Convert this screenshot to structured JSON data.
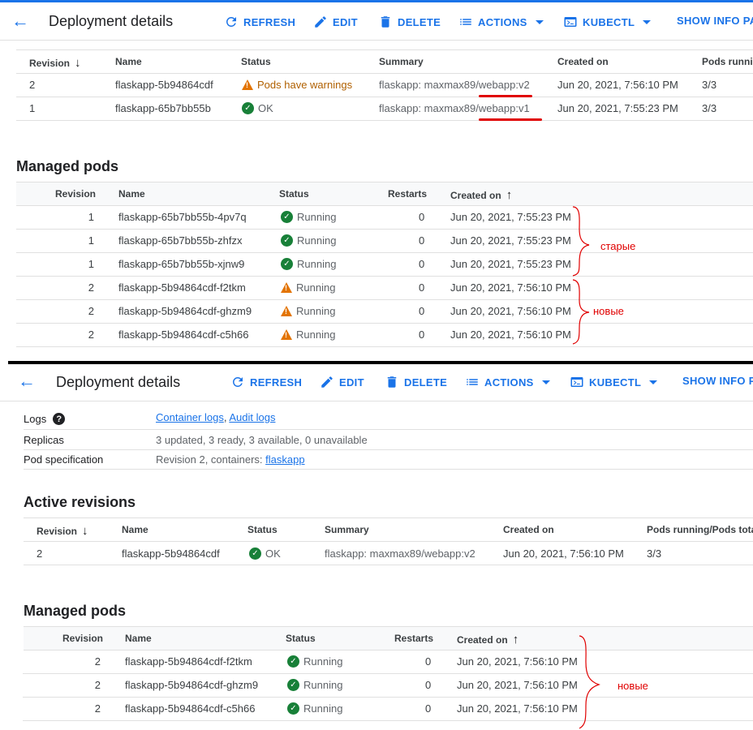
{
  "toolbar": {
    "title": "Deployment details",
    "refresh": "REFRESH",
    "edit": "EDIT",
    "delete": "DELETE",
    "actions": "ACTIONS",
    "kubectl": "KUBECTL",
    "show_info_top": "SHOW INFO PA",
    "show_info_bottom": "SHOW INFO P"
  },
  "top_revisions": {
    "headers": {
      "revision": "Revision",
      "name": "Name",
      "status": "Status",
      "summary": "Summary",
      "created": "Created on",
      "pods": "Pods runnin"
    },
    "rows": [
      {
        "revision": "2",
        "name": "flaskapp-5b94864cdf",
        "status": "Pods have warnings",
        "summary": "flaskapp: maxmax89/webapp:v2",
        "created": "Jun 20, 2021, 7:56:10 PM",
        "pods": "3/3"
      },
      {
        "revision": "1",
        "name": "flaskapp-65b7bb55b",
        "status": "OK",
        "summary": "flaskapp: maxmax89/webapp:v1",
        "created": "Jun 20, 2021, 7:55:23 PM",
        "pods": "3/3"
      }
    ]
  },
  "top_pods": {
    "section_title": "Managed pods",
    "headers": {
      "revision": "Revision",
      "name": "Name",
      "status": "Status",
      "restarts": "Restarts",
      "created": "Created on"
    },
    "rows": [
      {
        "revision": "1",
        "name": "flaskapp-65b7bb55b-4pv7q",
        "status": "Running",
        "restarts": "0",
        "created": "Jun 20, 2021, 7:55:23 PM"
      },
      {
        "revision": "1",
        "name": "flaskapp-65b7bb55b-zhfzx",
        "status": "Running",
        "restarts": "0",
        "created": "Jun 20, 2021, 7:55:23 PM"
      },
      {
        "revision": "1",
        "name": "flaskapp-65b7bb55b-xjnw9",
        "status": "Running",
        "restarts": "0",
        "created": "Jun 20, 2021, 7:55:23 PM"
      },
      {
        "revision": "2",
        "name": "flaskapp-5b94864cdf-f2tkm",
        "status": "Running",
        "restarts": "0",
        "created": "Jun 20, 2021, 7:56:10 PM"
      },
      {
        "revision": "2",
        "name": "flaskapp-5b94864cdf-ghzm9",
        "status": "Running",
        "restarts": "0",
        "created": "Jun 20, 2021, 7:56:10 PM"
      },
      {
        "revision": "2",
        "name": "flaskapp-5b94864cdf-c5h66",
        "status": "Running",
        "restarts": "0",
        "created": "Jun 20, 2021, 7:56:10 PM"
      }
    ],
    "annotations": {
      "old": "старые",
      "new": "новые"
    }
  },
  "info": {
    "logs_label": "Logs",
    "logs_link1": "Container logs",
    "logs_sep": ",",
    "logs_link2": "Audit logs",
    "replicas_label": "Replicas",
    "replicas_value": "3 updated, 3 ready, 3 available, 0 unavailable",
    "podspec_label": "Pod specification",
    "podspec_value": "Revision 2, containers:",
    "podspec_link": "flaskapp"
  },
  "active_revisions": {
    "section_title": "Active revisions",
    "headers": {
      "revision": "Revision",
      "name": "Name",
      "status": "Status",
      "summary": "Summary",
      "created": "Created on",
      "pods": "Pods running/Pods tota"
    },
    "rows": [
      {
        "revision": "2",
        "name": "flaskapp-5b94864cdf",
        "status": "OK",
        "summary": "flaskapp: maxmax89/webapp:v2",
        "created": "Jun 20, 2021, 7:56:10 PM",
        "pods": "3/3"
      }
    ]
  },
  "bottom_pods": {
    "section_title": "Managed pods",
    "headers": {
      "revision": "Revision",
      "name": "Name",
      "status": "Status",
      "restarts": "Restarts",
      "created": "Created on"
    },
    "rows": [
      {
        "revision": "2",
        "name": "flaskapp-5b94864cdf-f2tkm",
        "status": "Running",
        "restarts": "0",
        "created": "Jun 20, 2021, 7:56:10 PM"
      },
      {
        "revision": "2",
        "name": "flaskapp-5b94864cdf-ghzm9",
        "status": "Running",
        "restarts": "0",
        "created": "Jun 20, 2021, 7:56:10 PM"
      },
      {
        "revision": "2",
        "name": "flaskapp-5b94864cdf-c5h66",
        "status": "Running",
        "restarts": "0",
        "created": "Jun 20, 2021, 7:56:10 PM"
      }
    ],
    "annotations": {
      "new": "новые"
    }
  },
  "colors": {
    "accent": "#1a73e8",
    "ok": "#188038",
    "warning": "#e37400",
    "annotation": "#e00000"
  }
}
